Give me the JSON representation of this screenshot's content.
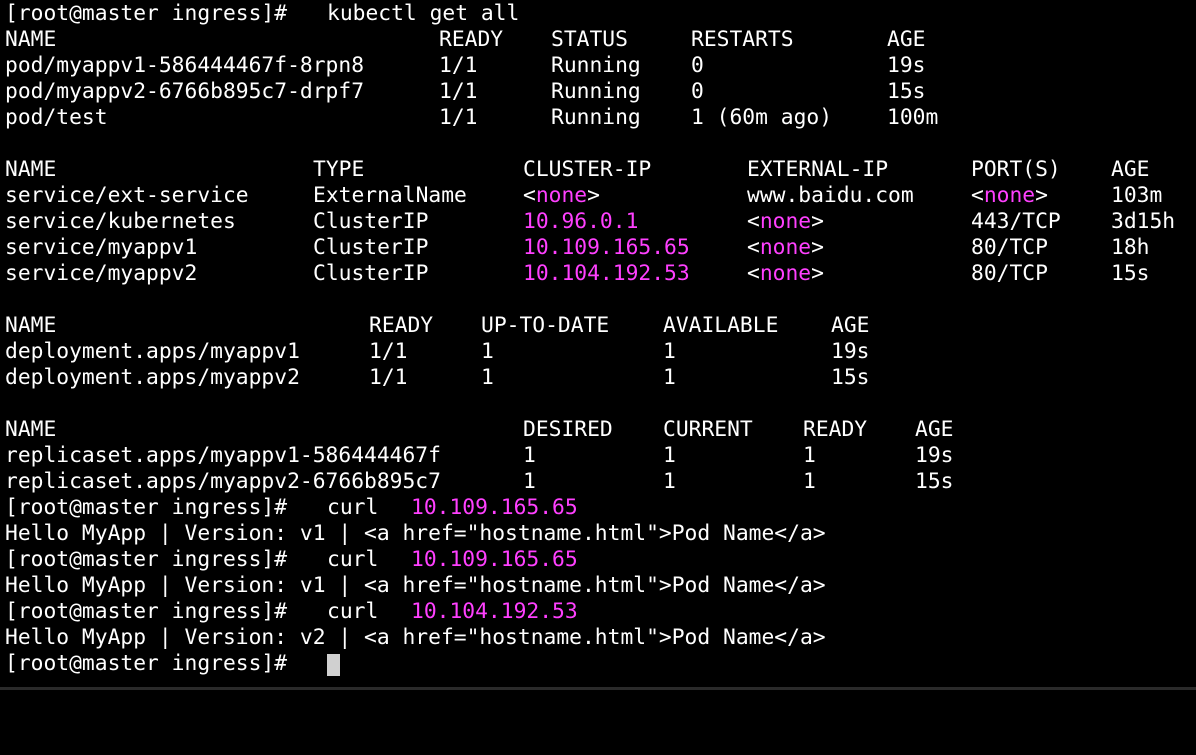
{
  "prompt": "[root@master ingress]#",
  "command": "kubectl get all",
  "pods": {
    "headers": [
      "NAME",
      "READY",
      "STATUS",
      "RESTARTS",
      "AGE"
    ],
    "rows": [
      [
        "pod/myappv1-586444467f-8rpn8",
        "1/1",
        "Running",
        "0",
        "19s"
      ],
      [
        "pod/myappv2-6766b895c7-drpf7",
        "1/1",
        "Running",
        "0",
        "15s"
      ],
      [
        "pod/test",
        "1/1",
        "Running",
        "1 (60m ago)",
        "100m"
      ]
    ]
  },
  "services": {
    "headers": [
      "NAME",
      "TYPE",
      "CLUSTER-IP",
      "EXTERNAL-IP",
      "PORT(S)",
      "AGE"
    ],
    "rows": [
      [
        "service/ext-service",
        "ExternalName",
        "none",
        "www.baidu.com",
        "none",
        "103m"
      ],
      [
        "service/kubernetes",
        "ClusterIP",
        "10.96.0.1",
        "none",
        "443/TCP",
        "3d15h"
      ],
      [
        "service/myappv1",
        "ClusterIP",
        "10.109.165.65",
        "none",
        "80/TCP",
        "18h"
      ],
      [
        "service/myappv2",
        "ClusterIP",
        "10.104.192.53",
        "none",
        "80/TCP",
        "15s"
      ]
    ]
  },
  "deployments": {
    "headers": [
      "NAME",
      "READY",
      "UP-TO-DATE",
      "AVAILABLE",
      "AGE"
    ],
    "rows": [
      [
        "deployment.apps/myappv1",
        "1/1",
        "1",
        "1",
        "19s"
      ],
      [
        "deployment.apps/myappv2",
        "1/1",
        "1",
        "1",
        "15s"
      ]
    ]
  },
  "replicasets": {
    "headers": [
      "NAME",
      "DESIRED",
      "CURRENT",
      "READY",
      "AGE"
    ],
    "rows": [
      [
        "replicaset.apps/myappv1-586444467f",
        "1",
        "1",
        "1",
        "19s"
      ],
      [
        "replicaset.apps/myappv2-6766b895c7",
        "1",
        "1",
        "1",
        "15s"
      ]
    ]
  },
  "curls": [
    {
      "cmd": "curl",
      "ip": "10.109.165.65",
      "output": "Hello MyApp | Version: v1 | <a href=\"hostname.html\">Pod Name</a>"
    },
    {
      "cmd": "curl",
      "ip": "10.109.165.65",
      "output": "Hello MyApp | Version: v1 | <a href=\"hostname.html\">Pod Name</a>"
    },
    {
      "cmd": "curl",
      "ip": "10.104.192.53",
      "output": "Hello MyApp | Version: v2 | <a href=\"hostname.html\">Pod Name</a>"
    }
  ],
  "colors": {
    "highlight": "#ff40ff",
    "background": "#000000",
    "foreground": "#ffffff"
  }
}
